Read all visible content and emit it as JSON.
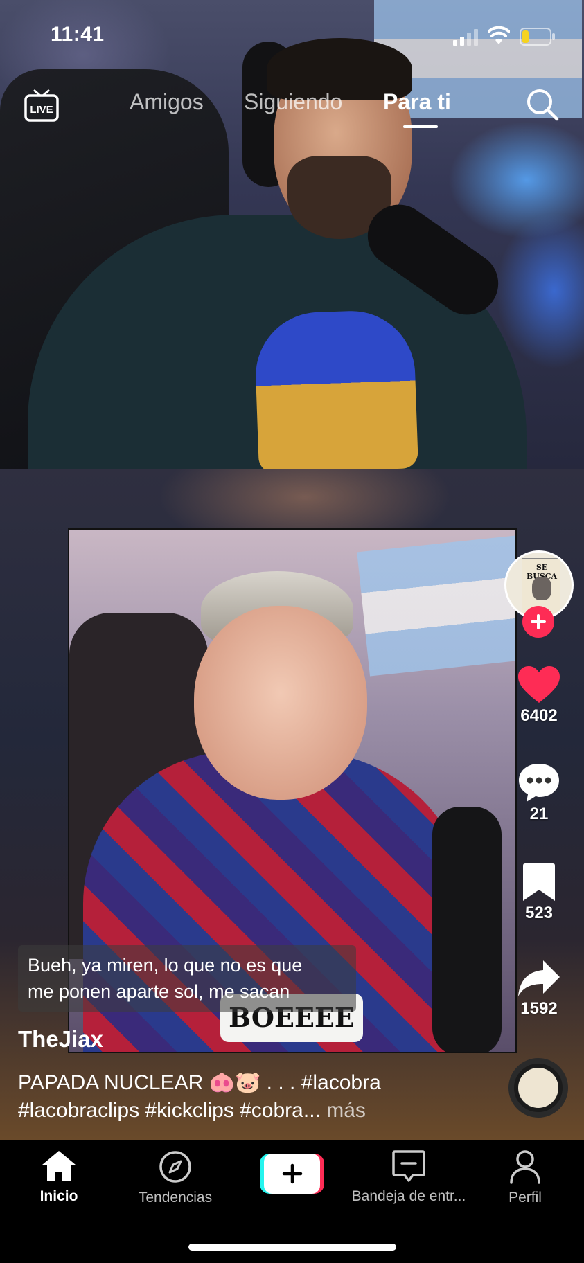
{
  "status_bar": {
    "time": "11:41"
  },
  "top_nav": {
    "live_label": "LIVE",
    "tabs": [
      {
        "label": "Amigos",
        "active": false
      },
      {
        "label": "Siguiendo",
        "active": false
      },
      {
        "label": "Para ti",
        "active": true
      }
    ]
  },
  "video": {
    "overlay_sign": "BOEEEE",
    "avatar_poster_text": "SE BUSCA"
  },
  "actions": {
    "likes": "6402",
    "comments": "21",
    "saves": "523",
    "shares": "1592"
  },
  "caption": {
    "subtitle_line1": "Bueh, ya miren, lo que no es que",
    "subtitle_line2": "me ponen aparte sol, me sacan",
    "username": "TheJiax",
    "description_line1": "PAPADA NUCLEAR 🐽🐷 . . . #lacobra",
    "description_line2": "#lacobraclips #kickclips #cobra...",
    "more_label": "más"
  },
  "bottom_nav": {
    "items": [
      {
        "label": "Inicio"
      },
      {
        "label": "Tendencias"
      },
      {
        "label": "Bandeja de entr..."
      },
      {
        "label": "Perfil"
      }
    ]
  },
  "colors": {
    "accent_red": "#fe2c55",
    "accent_cyan": "#25f4ee",
    "like_active": "#fe2c55"
  }
}
